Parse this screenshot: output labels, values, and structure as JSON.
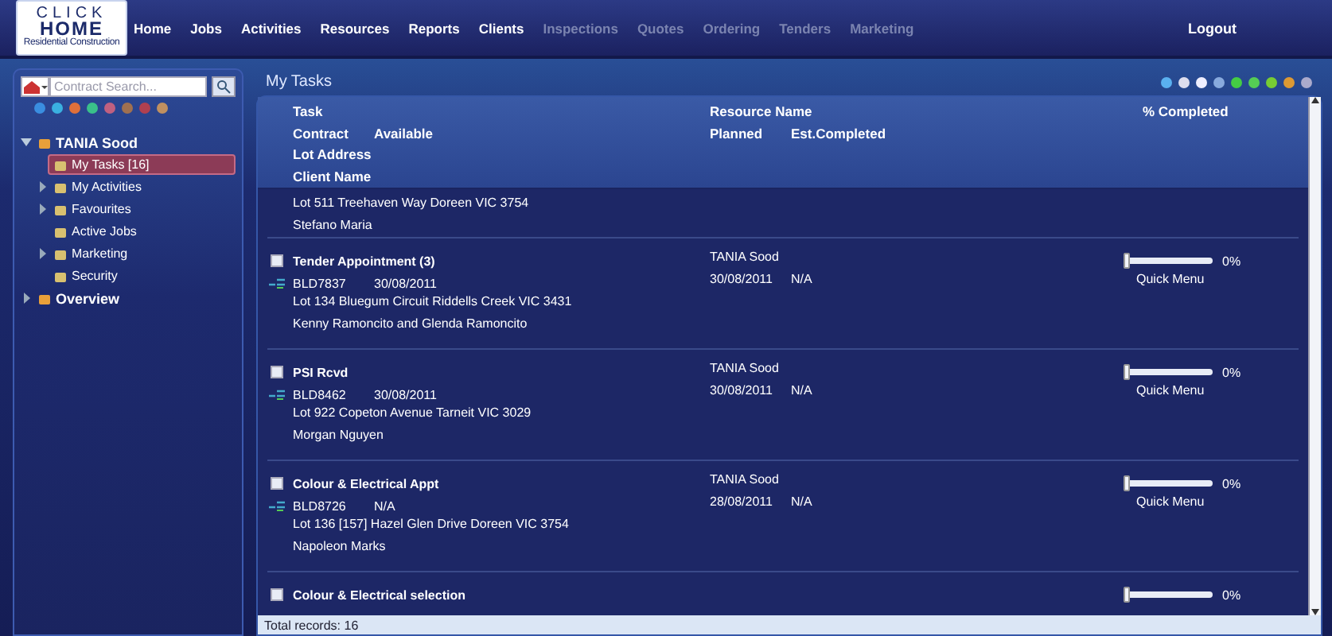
{
  "logo": {
    "line1": "CLICK",
    "line2": "HOME",
    "tagline": "Residential Construction"
  },
  "nav": [
    {
      "label": "Home",
      "disabled": false
    },
    {
      "label": "Jobs",
      "disabled": false
    },
    {
      "label": "Activities",
      "disabled": false
    },
    {
      "label": "Resources",
      "disabled": false
    },
    {
      "label": "Reports",
      "disabled": false
    },
    {
      "label": "Clients",
      "disabled": false
    },
    {
      "label": "Inspections",
      "disabled": true
    },
    {
      "label": "Quotes",
      "disabled": true
    },
    {
      "label": "Ordering",
      "disabled": true
    },
    {
      "label": "Tenders",
      "disabled": true
    },
    {
      "label": "Marketing",
      "disabled": true
    }
  ],
  "logout": "Logout",
  "sidebar": {
    "search": {
      "placeholder": "Contract Search..."
    },
    "tree": [
      {
        "label": "TANIA Sood",
        "expandable": true,
        "expanded": true,
        "selected": false,
        "children": [
          {
            "label": "My Tasks [16]",
            "expandable": false,
            "selected": true
          },
          {
            "label": "My Activities",
            "expandable": true,
            "expanded": false,
            "selected": false
          },
          {
            "label": "Favourites",
            "expandable": true,
            "expanded": false,
            "selected": false
          },
          {
            "label": "Active Jobs",
            "expandable": false,
            "selected": false
          },
          {
            "label": "Marketing",
            "expandable": true,
            "expanded": false,
            "selected": false
          },
          {
            "label": "Security",
            "expandable": false,
            "selected": false
          }
        ]
      },
      {
        "label": "Overview",
        "expandable": true,
        "expanded": false,
        "selected": false
      }
    ]
  },
  "main": {
    "title": "My Tasks",
    "header": {
      "task": "Task",
      "contract": "Contract",
      "available": "Available",
      "lot_address": "Lot Address",
      "client_name": "Client Name",
      "resource_name": "Resource Name",
      "planned": "Planned",
      "est_completed": "Est.Completed",
      "percent": "% Completed"
    },
    "rows": [
      {
        "kind": "partial",
        "address": "Lot 511 Treehaven Way Doreen VIC 3754",
        "client": "Stefano Maria"
      },
      {
        "kind": "task",
        "checked": false,
        "task": "Tender Appointment (3)",
        "contract": "BLD7837",
        "available": "30/08/2011",
        "address": "Lot 134 Bluegum Circuit Riddells Creek VIC 3431",
        "client": "Kenny Ramoncito and Glenda Ramoncito",
        "resource": "TANIA Sood",
        "planned": "30/08/2011",
        "est_completed": "N/A",
        "level": 0,
        "reading": "0%",
        "menu": "Quick Menu"
      },
      {
        "kind": "task",
        "checked": false,
        "task": "PSI Rcvd",
        "contract": "BLD8462",
        "available": "30/08/2011",
        "address": "Lot 922 Copeton Avenue Tarneit VIC 3029",
        "client": "Morgan Nguyen",
        "resource": "TANIA Sood",
        "planned": "30/08/2011",
        "est_completed": "N/A",
        "level": 0,
        "reading": "0%",
        "menu": "Quick Menu"
      },
      {
        "kind": "task",
        "checked": false,
        "task": "Colour & Electrical Appt",
        "contract": "BLD8726",
        "available": "N/A",
        "address": "Lot 136 [157] Hazel Glen Drive Doreen VIC 3754",
        "client": "Napoleon Marks",
        "resource": "TANIA Sood",
        "planned": "28/08/2011",
        "est_completed": "N/A",
        "level": 0,
        "reading": "0%",
        "menu": "Quick Menu"
      },
      {
        "kind": "task",
        "checked": false,
        "task": "Colour & Electrical selection",
        "level": 0,
        "reading": "0%"
      }
    ],
    "footer": "Total records: 16"
  }
}
